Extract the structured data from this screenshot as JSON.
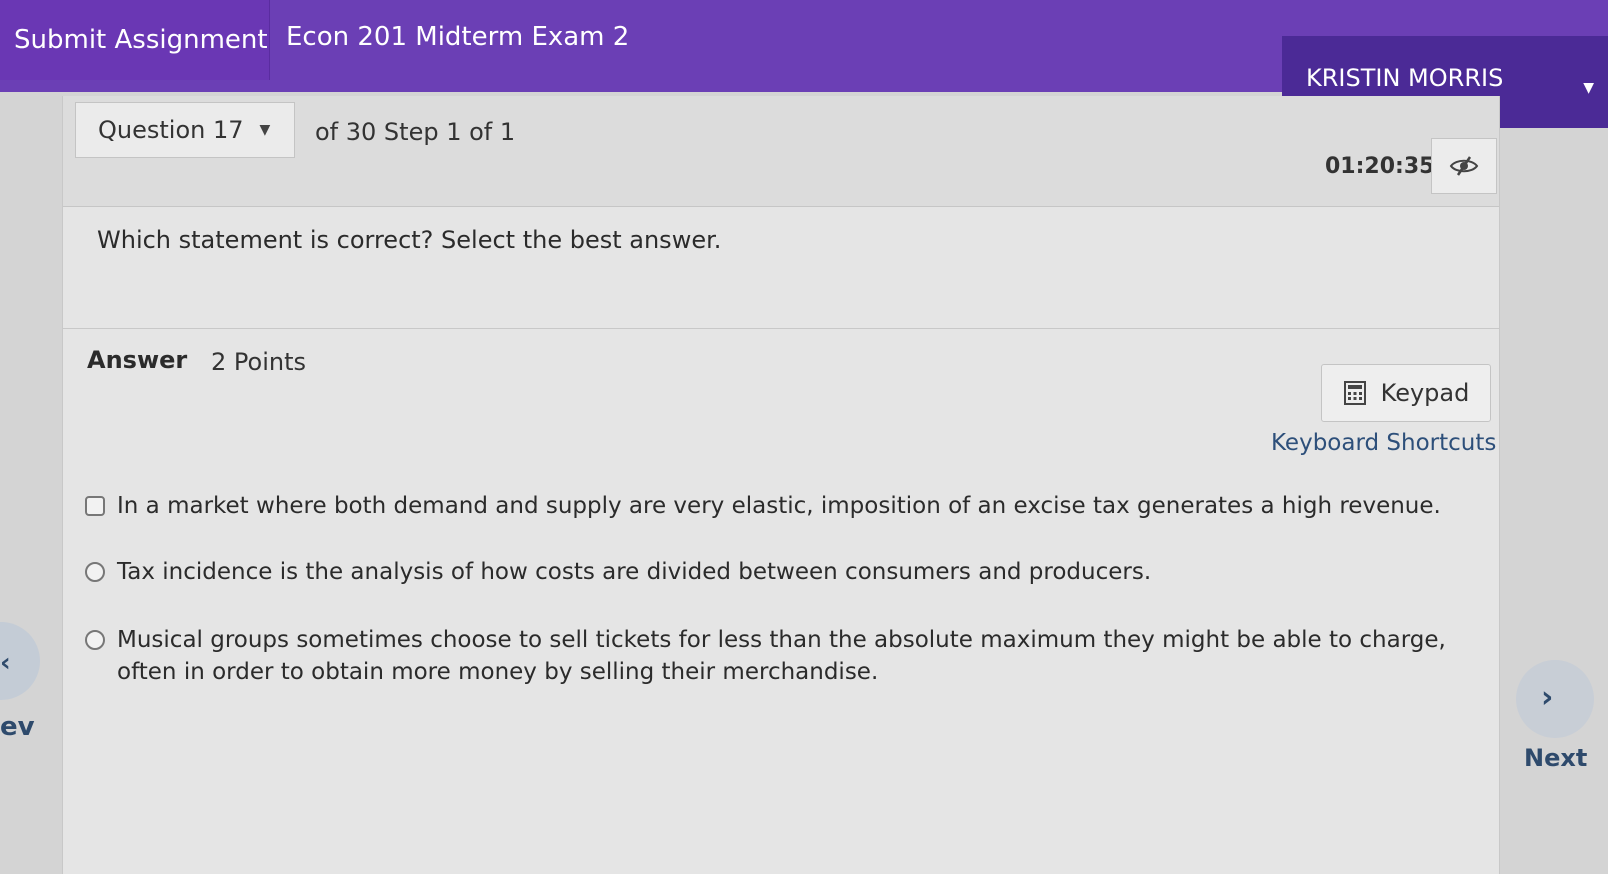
{
  "header": {
    "submit_label": "Submit Assignment",
    "exam_title": "Econ 201 Midterm Exam 2",
    "user_name": "KRISTIN MORRIS"
  },
  "question_nav": {
    "question_select": "Question 17",
    "of_step": "of 30 Step 1 of 1",
    "timer": "01:20:35"
  },
  "question": {
    "prompt": "Which statement is correct? Select the best answer."
  },
  "answer": {
    "label": "Answer",
    "points": "2 Points",
    "keypad_label": "Keypad",
    "keyboard_shortcuts": "Keyboard Shortcuts",
    "options": [
      {
        "text": "In a market where both demand and supply are very elastic, imposition of an excise tax generates a high revenue."
      },
      {
        "text": "Tax incidence is the analysis of how costs are divided between consumers and producers."
      },
      {
        "text": "Musical groups sometimes choose to sell tickets for less than the absolute maximum they might be able to charge, often in order to obtain more money by selling their merchandise."
      }
    ]
  },
  "nav": {
    "prev_label": "ev",
    "next_label": "Next"
  },
  "colors": {
    "header_purple": "#6b3fb5",
    "user_bar": "#4b2a96",
    "link_blue": "#2d4f7a"
  }
}
